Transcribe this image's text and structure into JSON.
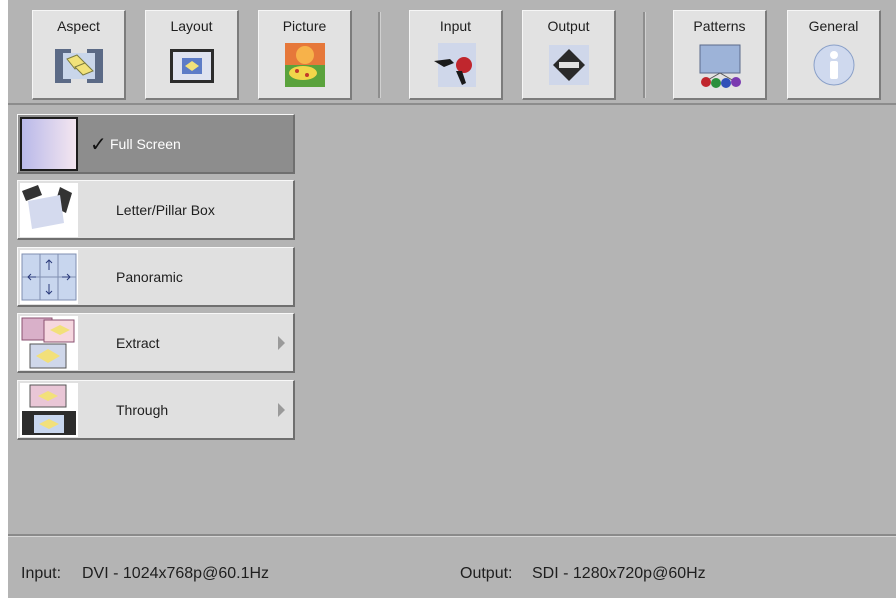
{
  "toolbar": {
    "buttons": [
      {
        "label": "Aspect",
        "icon": "aspect-icon"
      },
      {
        "label": "Layout",
        "icon": "layout-icon"
      },
      {
        "label": "Picture",
        "icon": "picture-icon"
      },
      {
        "label": "Input",
        "icon": "input-icon"
      },
      {
        "label": "Output",
        "icon": "output-icon"
      },
      {
        "label": "Patterns",
        "icon": "patterns-icon"
      },
      {
        "label": "General",
        "icon": "info-icon"
      }
    ]
  },
  "aspect_menu": {
    "items": [
      {
        "label": "Full Screen",
        "selected": true,
        "has_submenu": false,
        "icon": "full-screen-thumb-icon"
      },
      {
        "label": "Letter/Pillar Box",
        "selected": false,
        "has_submenu": false,
        "icon": "letter-pillar-box-thumb-icon"
      },
      {
        "label": "Panoramic",
        "selected": false,
        "has_submenu": false,
        "icon": "panoramic-thumb-icon"
      },
      {
        "label": "Extract",
        "selected": false,
        "has_submenu": true,
        "icon": "extract-thumb-icon"
      },
      {
        "label": "Through",
        "selected": false,
        "has_submenu": true,
        "icon": "through-thumb-icon"
      }
    ],
    "check_mark": "✓"
  },
  "status": {
    "input_label": "Input:",
    "input_value": "DVI - 1024x768p@60.1Hz",
    "output_label": "Output:",
    "output_value": "SDI - 1280x720p@60Hz"
  }
}
